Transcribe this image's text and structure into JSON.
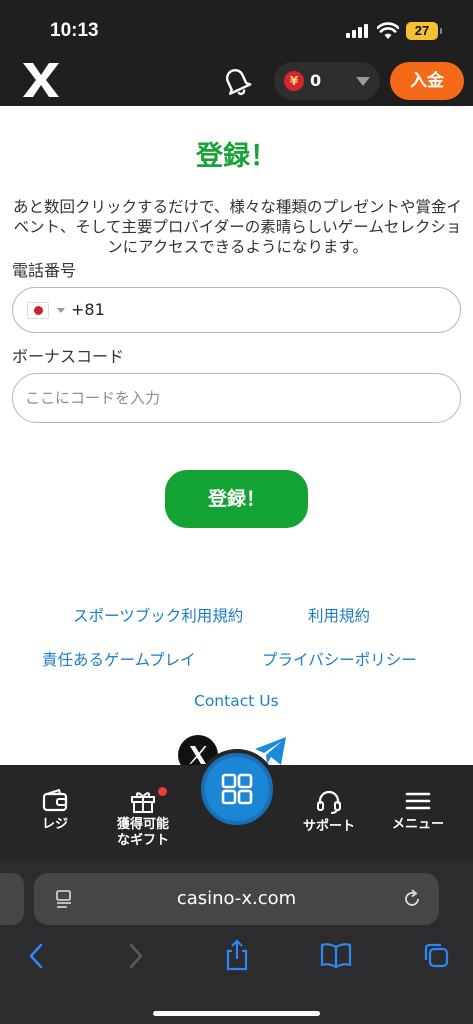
{
  "status_bar": {
    "time": "10:13",
    "battery": "27"
  },
  "header": {
    "logo": "X",
    "balance": "0",
    "currency_symbol": "¥",
    "deposit_label": "入金"
  },
  "form": {
    "title": "登録！",
    "description": "あと数回クリックするだけで、様々な種類のプレゼントや賞金イベント、そして主要プロバイダーの素晴らしいゲームセレクションにアクセスできるようになります。",
    "phone_label": "電話番号",
    "dial_code": "+81",
    "bonus_label": "ボーナスコード",
    "bonus_placeholder": "ここにコードを入力",
    "register_label": "登録！"
  },
  "links": {
    "sportsbook_terms": "スポーツブック利用規約",
    "terms": "利用規約",
    "responsible_gaming": "責任あるゲームプレイ",
    "privacy_policy": "プライバシーポリシー",
    "contact": "Contact Us"
  },
  "bottom_nav": {
    "cashier": "レジ",
    "gifts_line1": "獲得可能",
    "gifts_line2": "なギフト",
    "support": "サポート",
    "menu": "メニュー"
  },
  "browser": {
    "url": "casino-x.com"
  },
  "colors": {
    "accent_green": "#18a335",
    "deposit_orange": "#f56a16",
    "link_blue": "#1a7fc4",
    "center_blue": "#1c86d6"
  }
}
